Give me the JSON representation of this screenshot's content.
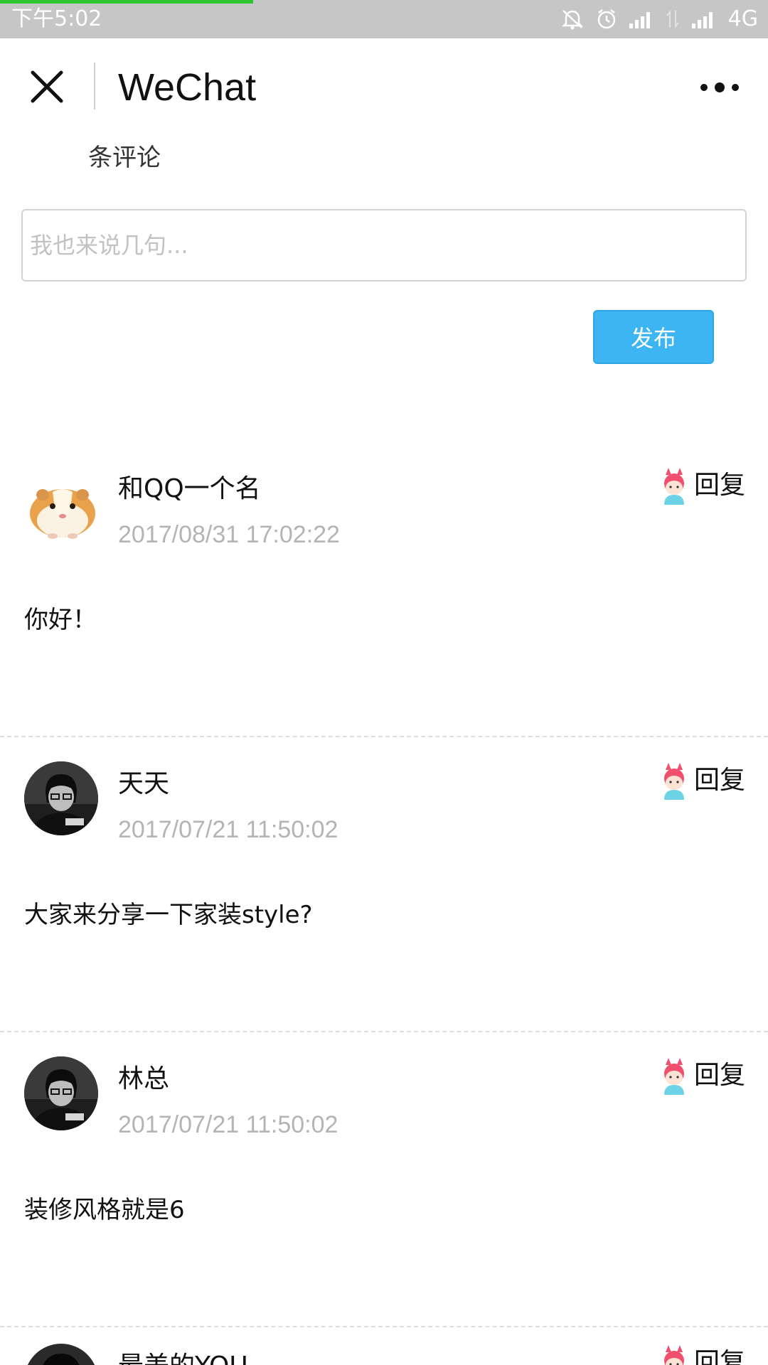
{
  "status_bar": {
    "time": "下午5:02",
    "network": "4G",
    "progress_fraction": 0.33,
    "progress_color": "#2fc52f"
  },
  "header": {
    "title": "WeChat",
    "close_icon": "close-icon",
    "more_icon": "more-dots-icon"
  },
  "comments_header": {
    "count_label": "条评论"
  },
  "input": {
    "placeholder": "我也来说几句..."
  },
  "publish_button": {
    "label": "发布",
    "color": "#3cb5f2"
  },
  "comments": [
    {
      "name": "和QQ一个名",
      "time": "2017/08/31 17:02:22",
      "text": "你好！",
      "avatar": "hamster-avatar",
      "reply_label": "回复"
    },
    {
      "name": "天天",
      "time": "2017/07/21 11:50:02",
      "text": "大家来分享一下家装style?",
      "avatar": "man-glasses-avatar",
      "reply_label": "回复"
    },
    {
      "name": "林总",
      "time": "2017/07/21 11:50:02",
      "text": "装修风格就是6",
      "avatar": "man-glasses-avatar",
      "reply_label": "回复"
    },
    {
      "name": "最美的YOU",
      "time": "",
      "text": "",
      "avatar": "woman-avatar",
      "reply_label": "回复"
    }
  ]
}
